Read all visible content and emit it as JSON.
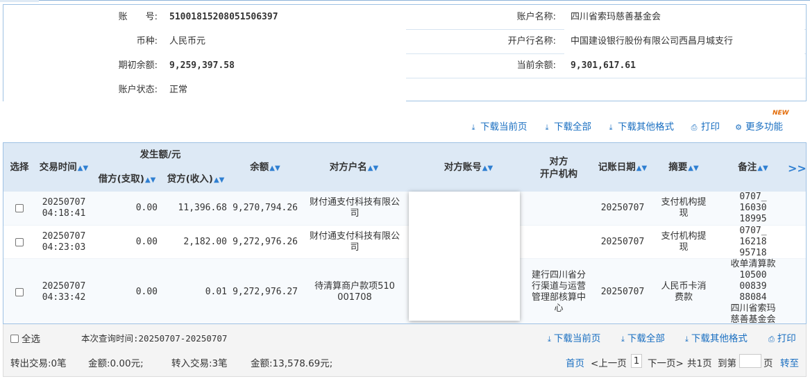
{
  "account": {
    "number_label": "账　　号:",
    "number_value": "51001815208051506397",
    "name_label": "账户名称:",
    "name_value": "四川省索玛慈善基金会",
    "currency_label": "币种:",
    "currency_value": "人民币元",
    "bank_label": "开户行名称:",
    "bank_value": "中国建设银行股份有限公司西昌月城支行",
    "opening_balance_label": "期初余额:",
    "opening_balance_value": "9,259,397.58",
    "current_balance_label": "当前余额:",
    "current_balance_value": "9,301,617.61",
    "status_label": "账户状态:",
    "status_value": "正常"
  },
  "toolbar": {
    "download_page": "下载当前页",
    "download_all": "下载全部",
    "download_other": "下载其他格式",
    "print": "打印",
    "more": "更多功能",
    "new_badge": "NEW"
  },
  "table": {
    "headers": {
      "select": "选择",
      "time": "交易时间",
      "amount_group": "发生额/元",
      "debit": "借方(支取)",
      "credit": "贷方(收入)",
      "balance": "余额",
      "counterparty_name": "对方户名",
      "counterparty_account": "对方账号",
      "counterparty_bank_1": "对方",
      "counterparty_bank_2": "开户机构",
      "post_date": "记账日期",
      "summary": "摘要",
      "remark": "备注",
      "more": ">>"
    },
    "rows": [
      {
        "time_date": "20250707",
        "time_clock": "04:18:41",
        "debit": "0.00",
        "credit": "11,396.68",
        "balance": "9,270,794.26",
        "counterparty_1": "财付通支付科技有限公",
        "counterparty_2": "司",
        "bank_1": "",
        "bank_2": "",
        "bank_3": "",
        "bank_4": "",
        "post_date": "20250707",
        "summary_1": "支付机构提",
        "summary_2": "现",
        "remark_1": "0707_",
        "remark_2": "16030",
        "remark_3": "18995",
        "remark_4": "",
        "remark_5": "",
        "remark_6": ""
      },
      {
        "time_date": "20250707",
        "time_clock": "04:23:03",
        "debit": "0.00",
        "credit": "2,182.00",
        "balance": "9,272,976.26",
        "counterparty_1": "财付通支付科技有限公",
        "counterparty_2": "司",
        "bank_1": "",
        "bank_2": "",
        "bank_3": "",
        "bank_4": "",
        "post_date": "20250707",
        "summary_1": "支付机构提",
        "summary_2": "现",
        "remark_1": "0707_",
        "remark_2": "16218",
        "remark_3": "95718",
        "remark_4": "",
        "remark_5": "",
        "remark_6": ""
      },
      {
        "time_date": "20250707",
        "time_clock": "04:33:42",
        "debit": "0.00",
        "credit": "0.01",
        "balance": "9,272,976.27",
        "counterparty_1": "待清算商户款项510",
        "counterparty_2": "001708",
        "bank_1": "建行四川省分",
        "bank_2": "行渠道与运营",
        "bank_3": "管理部核算中",
        "bank_4": "心",
        "post_date": "20250707",
        "summary_1": "人民币卡消",
        "summary_2": "费款",
        "remark_1": "收单清算款",
        "remark_2": "10500",
        "remark_3": "00839",
        "remark_4": "88084",
        "remark_5": "四川省索玛",
        "remark_6": "慈善基金会"
      }
    ]
  },
  "footer": {
    "select_all": "全选",
    "query_time": "本次查询时间:20250707-20250707",
    "download_page": "下载当前页",
    "download_all": "下载全部",
    "download_other": "下载其他格式",
    "print": "打印",
    "out_tx": "转出交易:0笔",
    "out_amount": "金额:0.00元;",
    "in_tx": "转入交易:3笔",
    "in_amount": "金额:13,578.69元;",
    "first_page": "首页",
    "prev_page": "<上一页",
    "current_page": "1",
    "next_page": "下一页>",
    "total_pages": "共1页",
    "goto_label": "到第",
    "page_unit": "页",
    "goto_button": "转至"
  },
  "colors": {
    "link": "#1a6fc1",
    "header_bg": "#dde9f5",
    "border": "#9ec1e3",
    "badge": "#e36c09"
  }
}
